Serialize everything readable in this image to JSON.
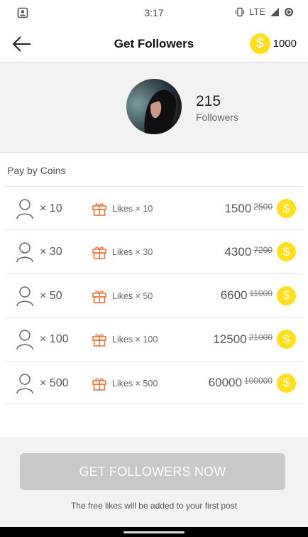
{
  "status_bar": {
    "time": "3:17",
    "network": "LTE"
  },
  "header": {
    "title": "Get Followers",
    "coin_balance": "1000",
    "coin_symbol": "$"
  },
  "profile": {
    "followers_count": "215",
    "followers_label": "Followers"
  },
  "section": {
    "pay_label": "Pay by Coins"
  },
  "packages": [
    {
      "qty": "× 10",
      "likes": "Likes × 10",
      "price": "1500",
      "old_price": "2500",
      "coin_symbol": "$"
    },
    {
      "qty": "× 30",
      "likes": "Likes × 30",
      "price": "4300",
      "old_price": "7200",
      "coin_symbol": "$"
    },
    {
      "qty": "× 50",
      "likes": "Likes × 50",
      "price": "6600",
      "old_price": "11000",
      "coin_symbol": "$"
    },
    {
      "qty": "× 100",
      "likes": "Likes × 100",
      "price": "12500",
      "old_price": "21000",
      "coin_symbol": "$"
    },
    {
      "qty": "× 500",
      "likes": "Likes × 500",
      "price": "60000",
      "old_price": "100000",
      "coin_symbol": "$"
    }
  ],
  "cta": {
    "label": "GET FOLLOWERS NOW",
    "footnote": "The free likes will be added to your first post"
  },
  "colors": {
    "coin": "#ffdd1f",
    "gift_icon": "#e8763a",
    "cta_disabled": "#c8c8c8",
    "panel_bg": "#f2f2f2"
  }
}
